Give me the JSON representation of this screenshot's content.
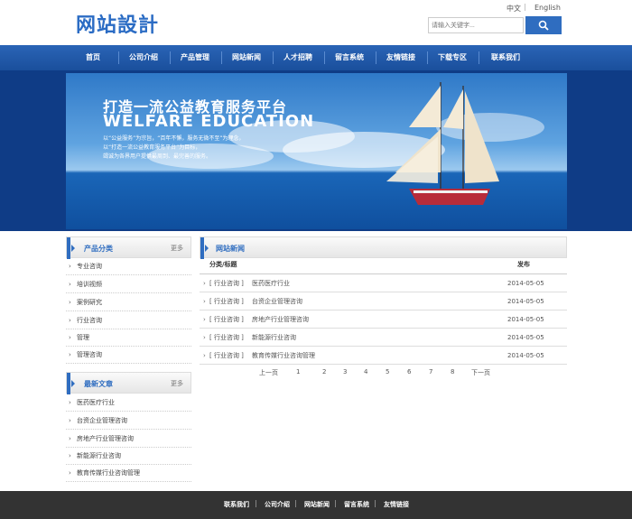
{
  "header": {
    "logo": "网站設計",
    "lang_cn": "中文",
    "lang_sep": "|",
    "lang_en": "English",
    "search_placeholder": "请输入关键字...",
    "search_icon": "magnifier-icon"
  },
  "nav": [
    "首页",
    "公司介绍",
    "产品管理",
    "网站新闻",
    "人才招聘",
    "留言系统",
    "友情链接",
    "下载专区",
    "联系我们"
  ],
  "banner": {
    "title_cn": "打造一流公益教育服务平台",
    "title_en": "WELFARE EDUCATION",
    "lines": [
      "以“公益服务”为宗旨，“百年不懈，服务无微不至”为理念，",
      "以“打造一流公益教育服务平台”为目标，",
      "竭诚为各界用户提供最周到、最完善的服务。"
    ]
  },
  "sidebar": {
    "products": {
      "title": "产品分类",
      "more": "更多",
      "items": [
        "专业咨询",
        "培训视频",
        "案例研究",
        "行业咨询",
        "管理",
        "管理咨询"
      ]
    },
    "articles": {
      "title": "最新文章",
      "more": "更多",
      "items": [
        "医药医疗行业",
        "台资企业管理咨询",
        "房地产行业管理咨询",
        "新能源行业咨询",
        "教育传媒行业咨询管理"
      ]
    }
  },
  "news": {
    "title": "网站新闻",
    "col_category": "分类/标题",
    "col_date": "发布",
    "rows": [
      {
        "cat": "[ 行业咨询 ]",
        "title": "医药医疗行业",
        "date": "2014-05-05"
      },
      {
        "cat": "[ 行业咨询 ]",
        "title": "台资企业管理咨询",
        "date": "2014-05-05"
      },
      {
        "cat": "[ 行业咨询 ]",
        "title": "房地产行业管理咨询",
        "date": "2014-05-05"
      },
      {
        "cat": "[ 行业咨询 ]",
        "title": "新能源行业咨询",
        "date": "2014-05-05"
      },
      {
        "cat": "[ 行业咨询 ]",
        "title": "教育传媒行业咨询管理",
        "date": "2014-05-05"
      }
    ],
    "pagination": {
      "prev": "上一页",
      "pages": [
        "1",
        "2",
        "3",
        "4",
        "5",
        "6",
        "7",
        "8"
      ],
      "next": "下一页"
    }
  },
  "footer": {
    "links": [
      "联系我们",
      "公司介绍",
      "网站新闻",
      "留言系统",
      "友情链接"
    ],
    "sep": "|"
  },
  "colors": {
    "brand": "#2f6dc0",
    "nav": "#1f57a6",
    "footer": "#333333"
  }
}
